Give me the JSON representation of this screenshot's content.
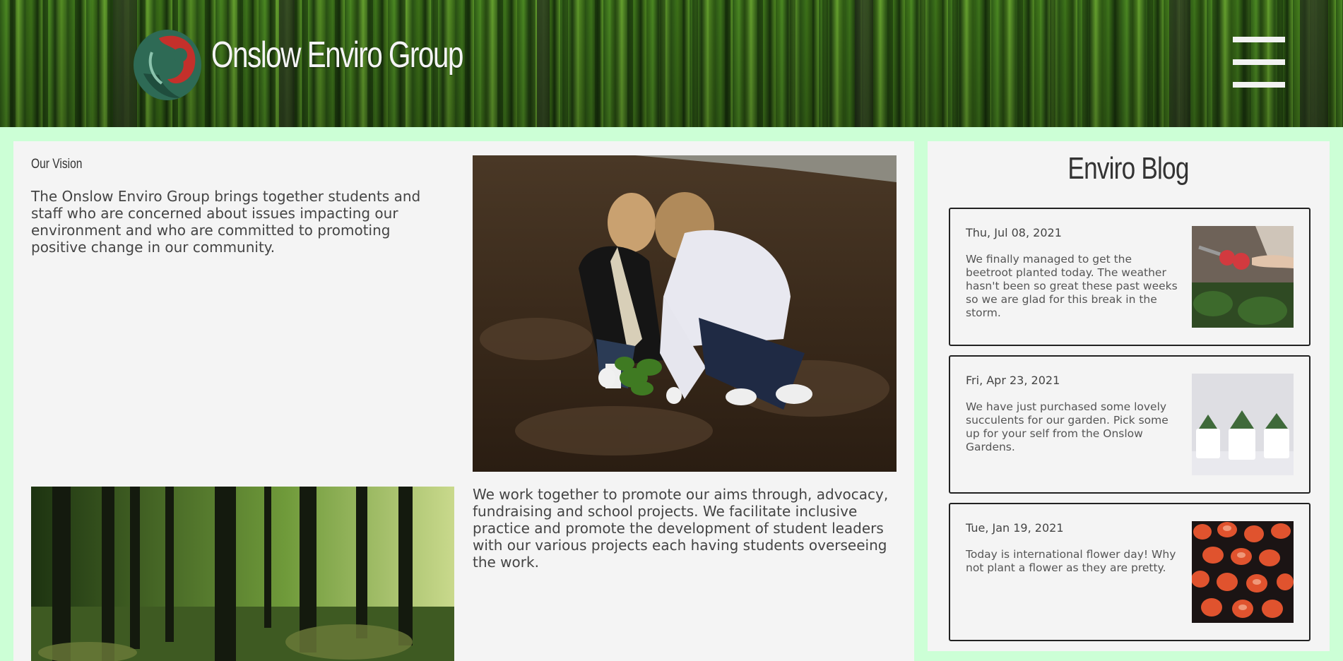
{
  "header": {
    "site_title": "Onslow Enviro Group",
    "logo_icon": "koru-bird-logo-icon",
    "menu_icon": "hamburger-menu-icon"
  },
  "main": {
    "vision_heading": "Our Vision",
    "vision_text": "The Onslow Enviro Group brings together students and staff who are concerned about issues impacting our environment and who are committed to promoting positive change in our community.",
    "work_text": "We work together to promote our aims through, advocacy, fundraising and school projects. We facilitate inclusive practice and promote the development of student leaders with our various projects each having students overseeing the work."
  },
  "blog": {
    "title": "Enviro Blog",
    "posts": [
      {
        "date": "Thu, Jul 08, 2021",
        "excerpt": "We finally managed to get the beetroot planted today. The weather hasn't been so great these past weeks so we are glad for this break in the storm."
      },
      {
        "date": "Fri, Apr 23, 2021",
        "excerpt": "We have just purchased some lovely succulents for our garden. Pick some up for your self from the Onslow Gardens."
      },
      {
        "date": "Tue, Jan 19, 2021",
        "excerpt": "Today is international flower day! Why not plant a flower as they are pretty."
      }
    ]
  },
  "colors": {
    "page_background": "#ccffd6",
    "panel_background": "#f4f4f4",
    "logo_green": "#2e6a55",
    "logo_red": "#c4302b"
  }
}
